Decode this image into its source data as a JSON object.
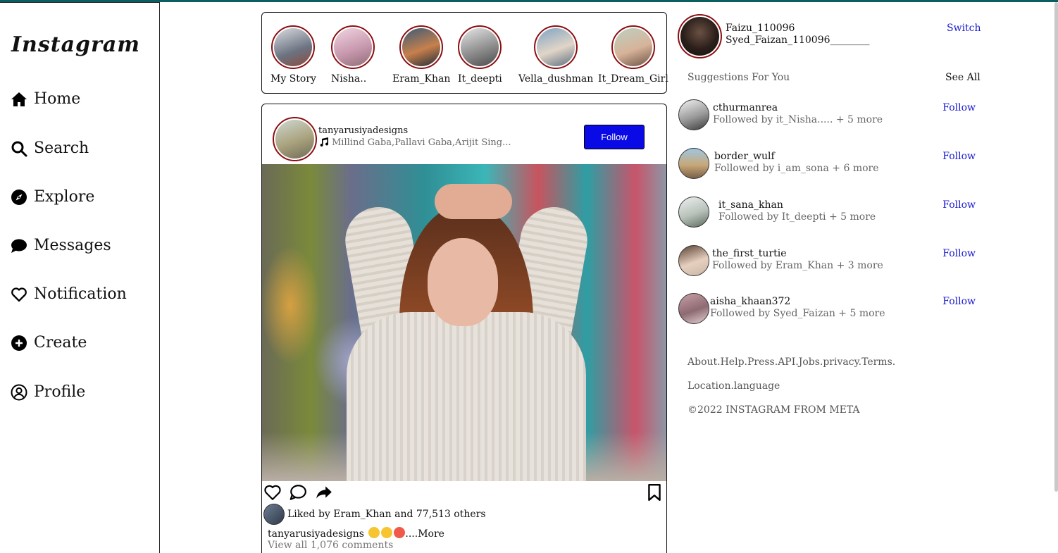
{
  "brand": {
    "logo": "Instagram"
  },
  "nav": [
    {
      "label": "Home",
      "icon": "home-icon"
    },
    {
      "label": "Search",
      "icon": "search-icon"
    },
    {
      "label": "Explore",
      "icon": "compass-icon"
    },
    {
      "label": "Messages",
      "icon": "message-icon"
    },
    {
      "label": "Notification",
      "icon": "heart-icon"
    },
    {
      "label": "Create",
      "icon": "plus-circle-icon"
    },
    {
      "label": "Profile",
      "icon": "user-circle-icon"
    }
  ],
  "stories": [
    {
      "name": "My Story"
    },
    {
      "name": "Nisha.."
    },
    {
      "name": "Eram_Khan"
    },
    {
      "name": "It_deepti"
    },
    {
      "name": "Vella_dushman"
    },
    {
      "name": "It_Dream_Girl"
    }
  ],
  "post": {
    "username": "tanyarusiyadesigns",
    "song": "Millind Gaba,Pallavi Gaba,Arijit Sing...",
    "follow_label": "Follow",
    "liked_by": "Liked by Eram_Khan and 77,513 others",
    "caption_user": "tanyarusiyadesigns",
    "caption_more": "....More",
    "comments": "View all 1,076 comments"
  },
  "me": {
    "username": "Faizu_110096",
    "name": "Syed_Faizan_110096________",
    "switch_label": "Switch"
  },
  "suggestions": {
    "title": "Suggestions For You",
    "see_all": "See All",
    "items": [
      {
        "username": "cthurmanrea",
        "followed_by": "Followed by it_Nisha..... + 5 more",
        "action": "Follow"
      },
      {
        "username": "border_wulf",
        "followed_by": "Followed by i_am_sona + 6 more",
        "action": "Follow"
      },
      {
        "username": "it_sana_khan",
        "followed_by": "Followed by It_deepti + 5 more",
        "action": "Follow"
      },
      {
        "username": "the_first_turtie",
        "followed_by": "Followed by Eram_Khan + 3 more",
        "action": "Follow"
      },
      {
        "username": "aisha_khaan372",
        "followed_by": "Followed by Syed_Faizan + 5 more",
        "action": "Follow"
      }
    ]
  },
  "footer": {
    "links": "About.Help.Press.API.Jobs.privacy.Terms.",
    "location": "Location.language",
    "copyright": "©2022 INSTAGRAM FROM META"
  }
}
